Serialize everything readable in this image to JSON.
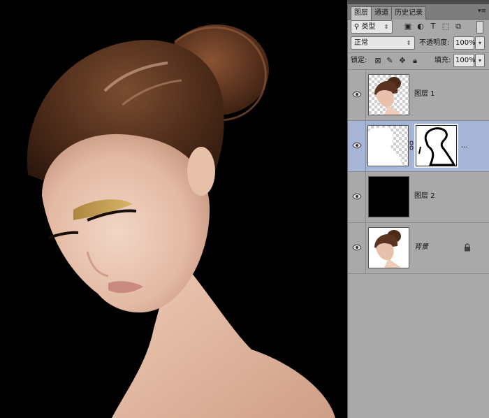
{
  "panel": {
    "tabs": [
      {
        "label": "图层",
        "active": true
      },
      {
        "label": "通道",
        "active": false
      },
      {
        "label": "历史记录",
        "active": false
      }
    ],
    "filter": {
      "icon": "search-icon",
      "value": "类型"
    },
    "filter_icons": [
      "image-filter-icon",
      "adjustment-filter-icon",
      "type-filter-icon",
      "shape-filter-icon",
      "smart-object-filter-icon",
      "filter-toggle-icon"
    ],
    "blend_mode": "正常",
    "opacity_label": "不透明度:",
    "opacity_value": "100%",
    "lock_label": "锁定:",
    "lock_icons": [
      "lock-transparent-icon",
      "lock-image-icon",
      "lock-position-icon",
      "lock-all-icon"
    ],
    "fill_label": "填充:",
    "fill_value": "100%"
  },
  "layers": [
    {
      "name": "图层 1",
      "visible": true,
      "selected": false,
      "thumb": "portrait-transparent"
    },
    {
      "name": "",
      "visible": true,
      "selected": true,
      "thumb": "transparent-white-shape",
      "mask": "outline-mask",
      "more": "..."
    },
    {
      "name": "图层 2",
      "visible": true,
      "selected": false,
      "thumb": "black-fill"
    },
    {
      "name": "背景",
      "visible": true,
      "selected": false,
      "thumb": "portrait-white",
      "locked": true
    }
  ],
  "colors": {
    "panel_bg": "#a9a9a9",
    "selected_layer": "#a6b5d6",
    "canvas_bg": "#000000"
  }
}
